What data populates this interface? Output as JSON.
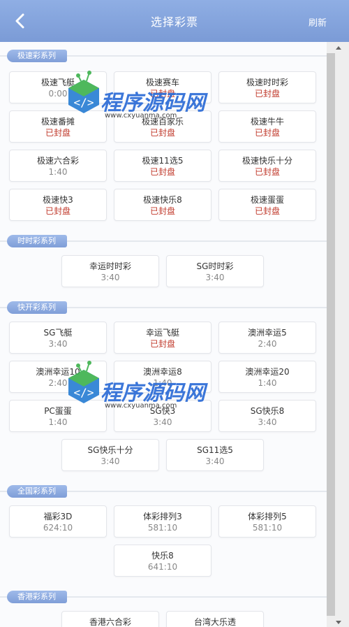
{
  "header": {
    "title": "选择彩票",
    "refresh_label": "刷新"
  },
  "watermark": {
    "text": "程序源码网",
    "url": "www.cxyuanma.com"
  },
  "sections": [
    {
      "label": "极速彩系列",
      "top": 0,
      "items": [
        {
          "name": "极速飞艇",
          "status": "0:00",
          "closed": false
        },
        {
          "name": "极速赛车",
          "status": "已封盘",
          "closed": true
        },
        {
          "name": "极速时时彩",
          "status": "已封盘",
          "closed": true
        },
        {
          "name": "极速番摊",
          "status": "已封盘",
          "closed": true
        },
        {
          "name": "极速百家乐",
          "status": "已封盘",
          "closed": true
        },
        {
          "name": "极速牛牛",
          "status": "已封盘",
          "closed": true
        },
        {
          "name": "极速六合彩",
          "status": "1:40",
          "closed": false
        },
        {
          "name": "极速11选5",
          "status": "已封盘",
          "closed": true
        },
        {
          "name": "极速快乐十分",
          "status": "已封盘",
          "closed": true
        },
        {
          "name": "极速快3",
          "status": "已封盘",
          "closed": true
        },
        {
          "name": "极速快乐8",
          "status": "已封盘",
          "closed": true
        },
        {
          "name": "极速蛋蛋",
          "status": "已封盘",
          "closed": true
        }
      ]
    },
    {
      "label": "时时彩系列",
      "items": [
        {
          "name": "幸运时时彩",
          "status": "3:40",
          "closed": false
        },
        {
          "name": "SG时时彩",
          "status": "3:40",
          "closed": false
        }
      ]
    },
    {
      "label": "快开彩系列",
      "items": [
        {
          "name": "SG飞艇",
          "status": "3:40",
          "closed": false
        },
        {
          "name": "幸运飞艇",
          "status": "已封盘",
          "closed": true
        },
        {
          "name": "澳洲幸运5",
          "status": "2:40",
          "closed": false
        },
        {
          "name": "澳洲幸运10",
          "status": "2:40",
          "closed": false
        },
        {
          "name": "澳洲幸运8",
          "status": "1:40",
          "closed": false
        },
        {
          "name": "澳洲幸运20",
          "status": "1:40",
          "closed": false
        },
        {
          "name": "PC蛋蛋",
          "status": "1:40",
          "closed": false
        },
        {
          "name": "SG快3",
          "status": "3:40",
          "closed": false
        },
        {
          "name": "SG快乐8",
          "status": "3:40",
          "closed": false
        },
        {
          "name": "SG快乐十分",
          "status": "3:40",
          "closed": false
        },
        {
          "name": "SG11选5",
          "status": "3:40",
          "closed": false
        }
      ]
    },
    {
      "label": "全国彩系列",
      "items": [
        {
          "name": "福彩3D",
          "status": "624:10",
          "closed": false
        },
        {
          "name": "体彩排列3",
          "status": "581:10",
          "closed": false
        },
        {
          "name": "体彩排列5",
          "status": "581:10",
          "closed": false
        },
        {
          "name": "快乐8",
          "status": "641:10",
          "closed": false
        }
      ]
    },
    {
      "label": "香港彩系列",
      "items": [
        {
          "name": "香港六合彩",
          "status": "",
          "closed": false
        },
        {
          "name": "台湾大乐透",
          "status": "",
          "closed": false
        }
      ]
    }
  ]
}
